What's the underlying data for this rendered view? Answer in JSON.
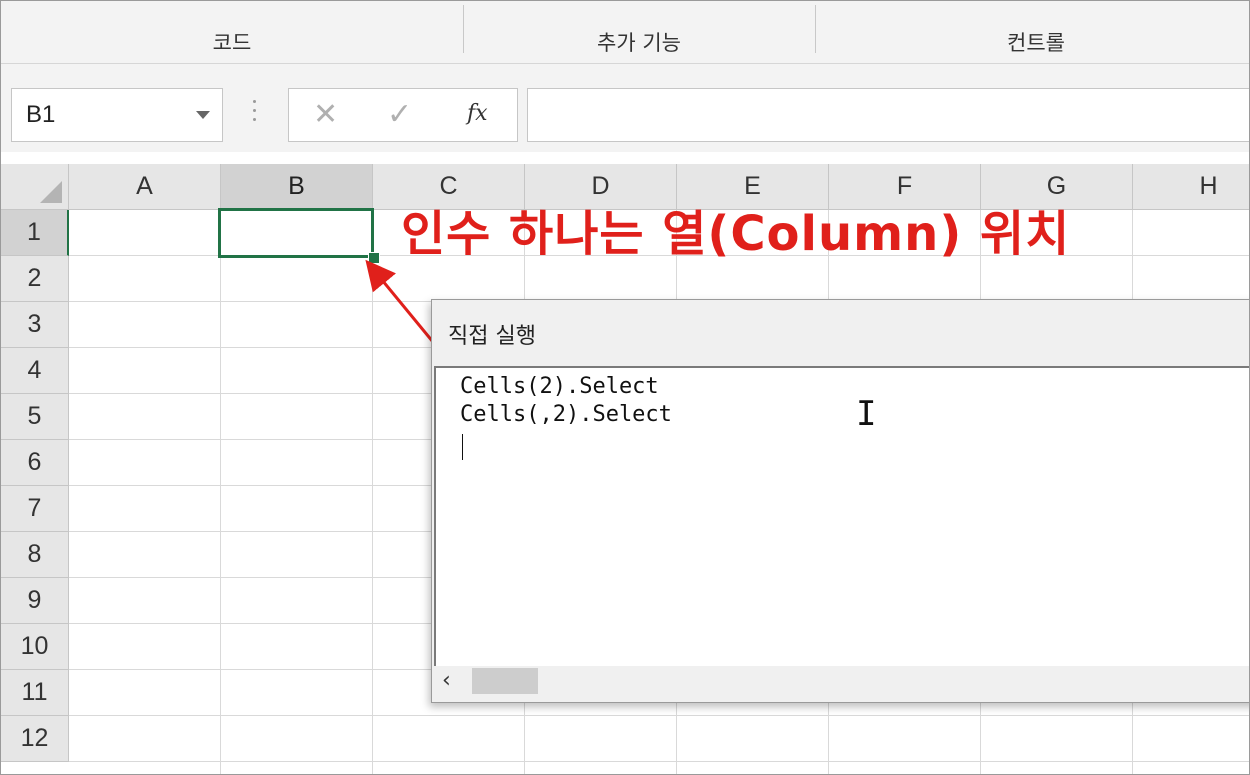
{
  "ribbon": {
    "groups": [
      "코드",
      "추가 기능",
      "컨트롤"
    ]
  },
  "formula_bar": {
    "name_box": "B1",
    "cancel_glyph": "✕",
    "enter_glyph": "✓",
    "fx_label": "fx",
    "formula": ""
  },
  "sheet": {
    "columns": [
      "A",
      "B",
      "C",
      "D",
      "E",
      "F",
      "G",
      "H"
    ],
    "rows": [
      "1",
      "2",
      "3",
      "4",
      "5",
      "6",
      "7",
      "8",
      "9",
      "10",
      "11",
      "12"
    ],
    "selected_column": "B",
    "selected_row": "1"
  },
  "annotation": {
    "text": "인수 하나는 열(Column) 위치",
    "color": "#e0201b"
  },
  "immediate_window": {
    "title": "직접 실행",
    "lines": [
      "Cells(2).Select",
      "Cells(,2).Select"
    ]
  },
  "colors": {
    "accent": "#217346"
  }
}
